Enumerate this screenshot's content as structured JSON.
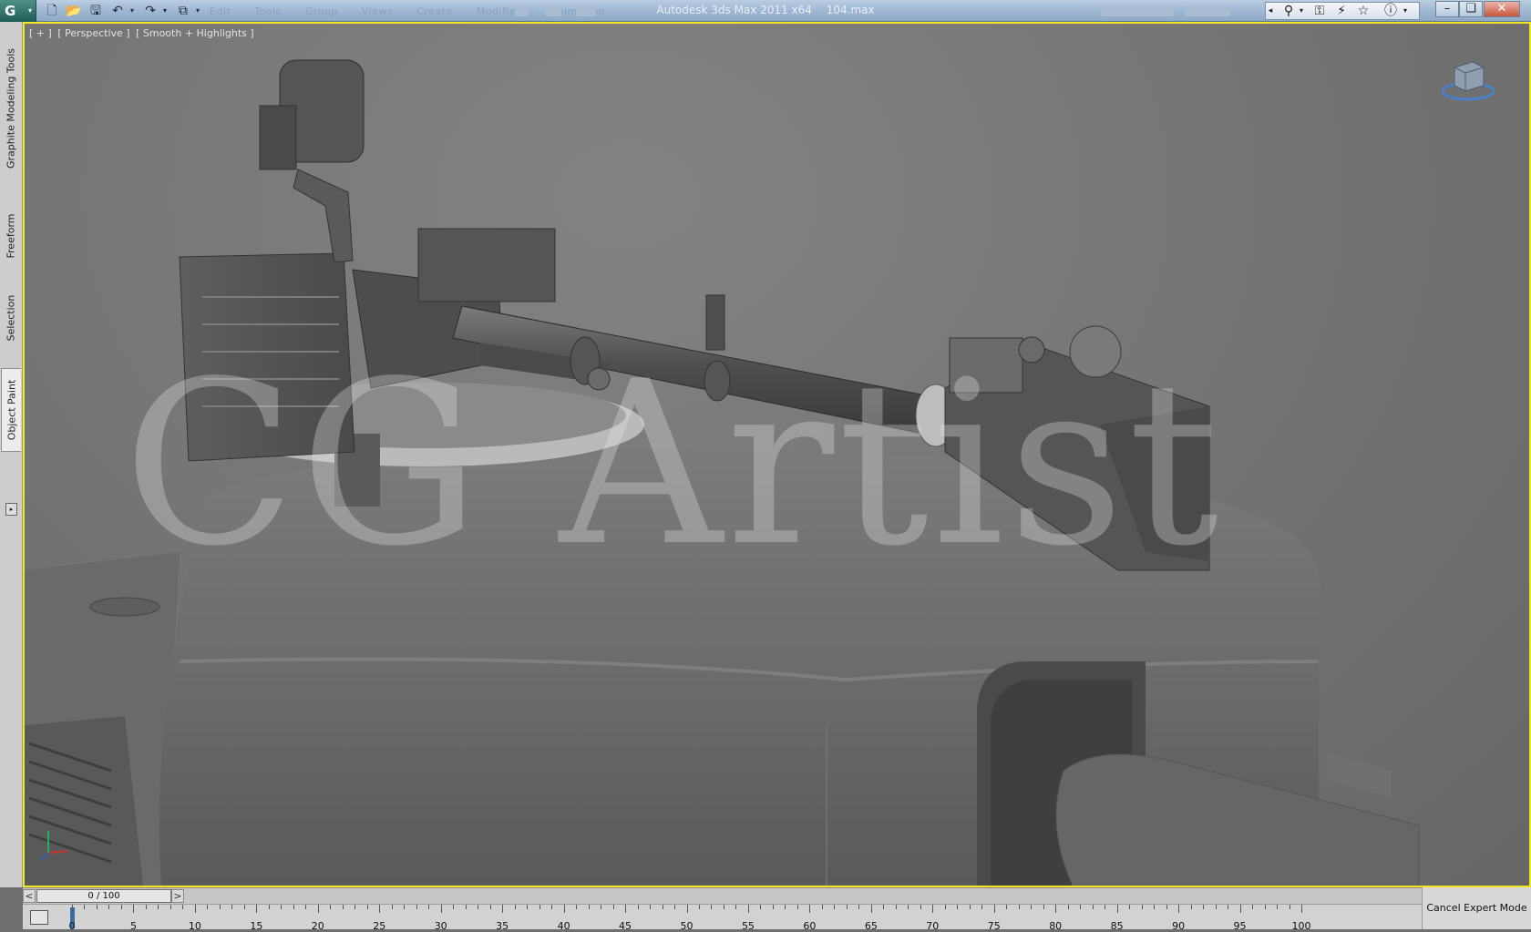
{
  "title_bar": {
    "app_name": "Autodesk 3ds Max  2011 x64",
    "file_name": "104.max",
    "faint_menu": [
      "Edit",
      "Tools",
      "Group",
      "Views",
      "Create",
      "Modifiers",
      "Animation"
    ],
    "quick_access_icons": [
      "new-file-icon",
      "open-file-icon",
      "save-icon",
      "undo-icon",
      "redo-icon",
      "project-folder-icon"
    ],
    "infocenter_icons": [
      "binoculars-icon",
      "key-icon",
      "satellite-icon",
      "star-icon",
      "help-icon"
    ],
    "window_controls": {
      "minimize": "–",
      "restore": "❏",
      "close": "✕"
    }
  },
  "left_panel": {
    "tabs": [
      "Graphite Modeling Tools",
      "Freeform",
      "Selection",
      "Object Paint"
    ],
    "active_tab": "Object Paint"
  },
  "viewport": {
    "label_parts": [
      "[ + ]",
      "[ Perspective ]",
      "[ Smooth + Highlights ]"
    ],
    "watermark": "CG Artist",
    "border_color": "#f0e520"
  },
  "time_slider": {
    "prev": "<",
    "next": ">",
    "frame_display": "0 / 100",
    "current_frame": 0,
    "total_frames": 100
  },
  "track_bar": {
    "ticks": [
      "0",
      "5",
      "10",
      "15",
      "20",
      "25",
      "30",
      "35",
      "40",
      "45",
      "50",
      "55",
      "60",
      "65",
      "70",
      "75",
      "80",
      "85",
      "90",
      "95",
      "100"
    ]
  },
  "expert_mode": {
    "label": "Cancel Expert Mode"
  }
}
